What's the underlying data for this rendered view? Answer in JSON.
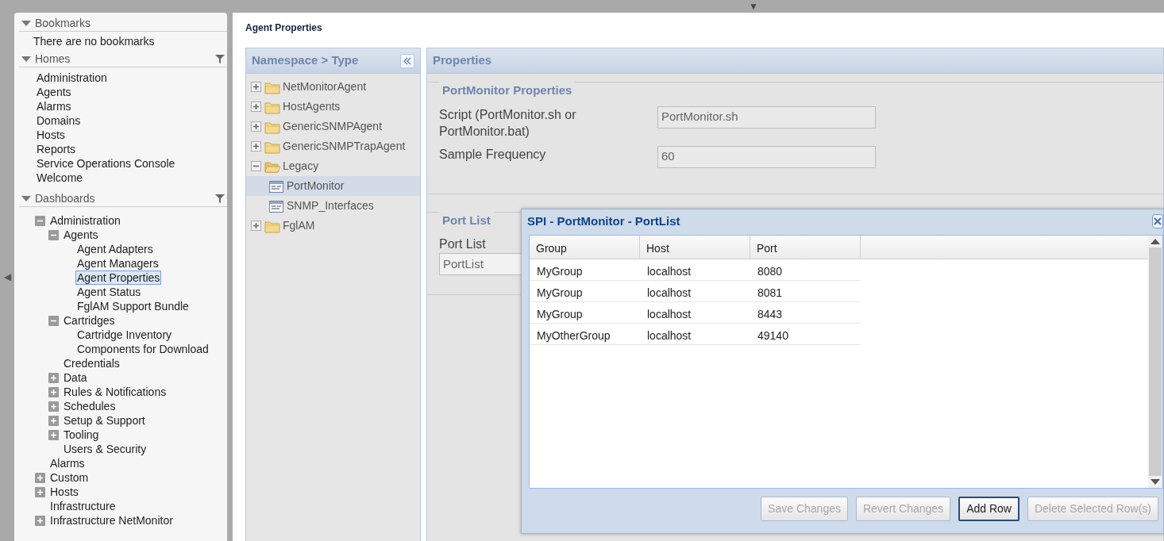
{
  "top_bar": {
    "toggle": "▼"
  },
  "side_toggle": "◀",
  "sidebar": {
    "sections": [
      {
        "title": "Bookmarks",
        "expanded": true,
        "message": "There are no bookmarks"
      },
      {
        "title": "Homes",
        "expanded": true,
        "filter": true,
        "items": [
          {
            "label": "Administration",
            "selected": false
          },
          {
            "label": "Agents",
            "selected": false
          },
          {
            "label": "Alarms",
            "selected": false
          },
          {
            "label": "Domains",
            "selected": false
          },
          {
            "label": "Hosts",
            "selected": false
          },
          {
            "label": "Reports",
            "selected": false
          },
          {
            "label": "Service Operations Console",
            "selected": false
          },
          {
            "label": "Welcome",
            "selected": false
          }
        ]
      },
      {
        "title": "Dashboards",
        "expanded": true,
        "filter": true,
        "tree": [
          {
            "label": "Administration",
            "expanded": true,
            "selected": false,
            "children": [
              {
                "label": "Agents",
                "expanded": true,
                "selected": false,
                "children": [
                  {
                    "label": "Agent Adapters",
                    "selected": false
                  },
                  {
                    "label": "Agent Managers",
                    "selected": false
                  },
                  {
                    "label": "Agent Properties",
                    "selected": true
                  },
                  {
                    "label": "Agent Status",
                    "selected": false
                  },
                  {
                    "label": "FglAM Support Bundle",
                    "selected": false
                  }
                ]
              },
              {
                "label": "Cartridges",
                "expanded": true,
                "selected": false,
                "children": [
                  {
                    "label": "Cartridge Inventory",
                    "selected": false
                  },
                  {
                    "label": "Components for Download",
                    "selected": false
                  }
                ]
              },
              {
                "label": "Credentials",
                "selected": false
              },
              {
                "label": "Data",
                "expanded": false,
                "selected": false
              },
              {
                "label": "Rules & Notifications",
                "expanded": false,
                "selected": false
              },
              {
                "label": "Schedules",
                "expanded": false,
                "selected": false
              },
              {
                "label": "Setup & Support",
                "expanded": false,
                "selected": false
              },
              {
                "label": "Tooling",
                "expanded": false,
                "selected": false
              },
              {
                "label": "Users & Security",
                "selected": false
              }
            ]
          },
          {
            "label": "Alarms",
            "selected": false
          },
          {
            "label": "Custom",
            "expanded": false,
            "selected": false
          },
          {
            "label": "Hosts",
            "expanded": false,
            "selected": false
          },
          {
            "label": "Infrastructure",
            "selected": false
          },
          {
            "label": "Infrastructure NetMonitor",
            "expanded": false,
            "selected": false
          }
        ]
      }
    ]
  },
  "main": {
    "title": "Agent Properties",
    "namespace_panel": {
      "title": "Namespace > Type",
      "tree": [
        {
          "label": "NetMonitorAgent",
          "kind": "folder",
          "expanded": false,
          "selected": false
        },
        {
          "label": "HostAgents",
          "kind": "folder",
          "expanded": false,
          "selected": false
        },
        {
          "label": "GenericSNMPAgent",
          "kind": "folder",
          "expanded": false,
          "selected": false
        },
        {
          "label": "GenericSNMPTrapAgent",
          "kind": "folder",
          "expanded": false,
          "selected": false
        },
        {
          "label": "Legacy",
          "kind": "folder",
          "expanded": true,
          "selected": false,
          "children": [
            {
              "label": "PortMonitor",
              "kind": "document",
              "selected": true
            },
            {
              "label": "SNMP_Interfaces",
              "kind": "document",
              "selected": false
            }
          ]
        },
        {
          "label": "FglAM",
          "kind": "folder",
          "expanded": false,
          "selected": false
        }
      ]
    },
    "properties_panel": {
      "title": "Properties",
      "fieldsets": [
        {
          "legend": "PortMonitor Properties",
          "fields": [
            {
              "label": "Script (PortMonitor.sh or PortMonitor.bat)",
              "value": "PortMonitor.sh",
              "kind": "text"
            },
            {
              "label": "Sample Frequency",
              "value": "60",
              "kind": "text"
            }
          ]
        },
        {
          "legend": "Port List",
          "fields": [
            {
              "label": "Port List",
              "value": "PortList",
              "kind": "select"
            }
          ]
        }
      ]
    }
  },
  "dialog": {
    "title": "SPI - PortMonitor - PortList",
    "columns": [
      "Group",
      "Host",
      "Port"
    ],
    "rows": [
      [
        "MyGroup",
        "localhost",
        "8080"
      ],
      [
        "MyGroup",
        "localhost",
        "8081"
      ],
      [
        "MyGroup",
        "localhost",
        "8443"
      ],
      [
        "MyOtherGroup",
        "localhost",
        "49140"
      ]
    ],
    "buttons": [
      {
        "label": "Save Changes",
        "disabled": true
      },
      {
        "label": "Revert Changes",
        "disabled": true
      },
      {
        "label": "Add Row",
        "disabled": false
      },
      {
        "label": "Delete Selected Row(s)",
        "disabled": true
      }
    ]
  }
}
